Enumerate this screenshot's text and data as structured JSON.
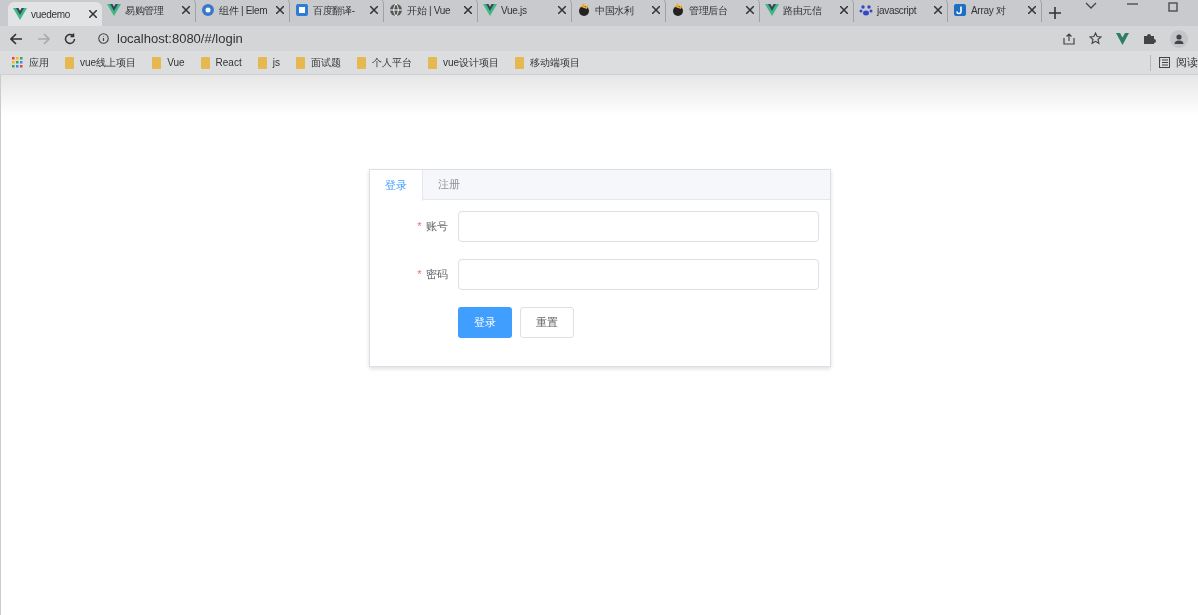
{
  "browser": {
    "tabs": [
      {
        "title": "vuedemo",
        "kind": "vue",
        "selected": true
      },
      {
        "title": "易购管理",
        "kind": "vue",
        "selected": false
      },
      {
        "title": "组件 | Elem",
        "kind": "disc",
        "selected": false
      },
      {
        "title": "百度翻译-",
        "kind": "square",
        "selected": false
      },
      {
        "title": "开始 | Vue",
        "kind": "globe",
        "selected": false
      },
      {
        "title": "Vue.js",
        "kind": "vue",
        "selected": false
      },
      {
        "title": "中国水利",
        "kind": "flame",
        "selected": false
      },
      {
        "title": "管理后台",
        "kind": "flame",
        "selected": false
      },
      {
        "title": "路由元信",
        "kind": "vue",
        "selected": false
      },
      {
        "title": "javascript",
        "kind": "paw",
        "selected": false
      },
      {
        "title": "Array 对",
        "kind": "j",
        "selected": false
      }
    ],
    "url": "localhost:8080/#/login",
    "bookmarks": [
      {
        "label": "应用",
        "kind": "apps"
      },
      {
        "label": "vue线上项目",
        "kind": "folder"
      },
      {
        "label": "Vue",
        "kind": "folder"
      },
      {
        "label": "React",
        "kind": "folder"
      },
      {
        "label": "js",
        "kind": "folder"
      },
      {
        "label": "面试题",
        "kind": "folder"
      },
      {
        "label": "个人平台",
        "kind": "folder"
      },
      {
        "label": "vue设计项目",
        "kind": "folder"
      },
      {
        "label": "移动端项目",
        "kind": "folder"
      }
    ],
    "reading_list": "阅读"
  },
  "login": {
    "tabs": [
      {
        "label": "登录",
        "selected": true
      },
      {
        "label": "注册",
        "selected": false
      }
    ],
    "fields": [
      {
        "label": "账号",
        "required_mark": "*"
      },
      {
        "label": "密码",
        "required_mark": "*"
      }
    ],
    "buttons": [
      {
        "label": "登录",
        "kind": "primary"
      },
      {
        "label": "重置",
        "kind": "default"
      }
    ]
  }
}
